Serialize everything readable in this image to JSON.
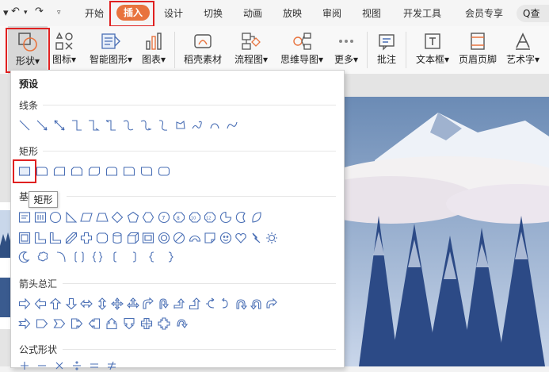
{
  "menubar": {
    "tabs": [
      {
        "label": "开始"
      },
      {
        "label": "插入"
      },
      {
        "label": "设计"
      },
      {
        "label": "切换"
      },
      {
        "label": "动画"
      },
      {
        "label": "放映"
      },
      {
        "label": "审阅"
      },
      {
        "label": "视图"
      },
      {
        "label": "开发工具"
      },
      {
        "label": "会员专享"
      }
    ],
    "active_tab": "插入",
    "search_label": "Q查",
    "accent": "#e8733e"
  },
  "ribbon": {
    "buttons": [
      {
        "label": "形状"
      },
      {
        "label": "图标"
      },
      {
        "label": "智能图形"
      },
      {
        "label": "图表"
      },
      {
        "label": "稻壳素材"
      },
      {
        "label": "流程图"
      },
      {
        "label": "思维导图"
      },
      {
        "label": "更多"
      },
      {
        "label": "批注"
      },
      {
        "label": "文本框"
      },
      {
        "label": "页眉页脚"
      },
      {
        "label": "艺术字"
      }
    ]
  },
  "shapes_panel": {
    "title": "预设",
    "sections": {
      "lines": "线条",
      "rectangles": "矩形",
      "basic_partial": "基",
      "arrows": "箭头总汇",
      "formula": "公式形状"
    },
    "tooltip": "矩形",
    "shape_color": "#4a6fb5"
  }
}
